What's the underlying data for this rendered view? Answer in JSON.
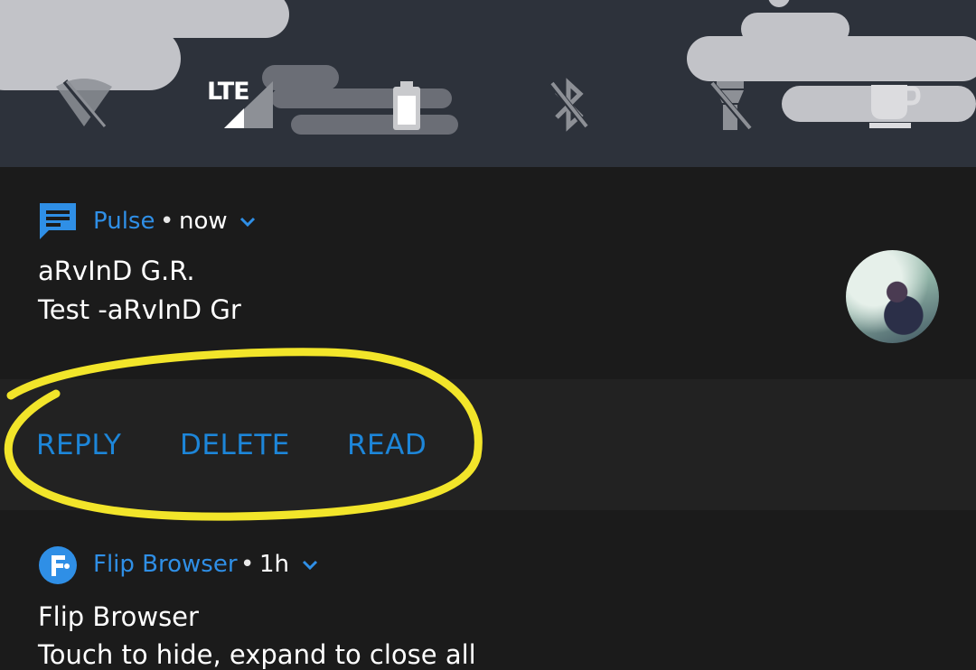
{
  "status_tiles": {
    "wifi": {
      "icon": "wifi-off-icon",
      "state": "off"
    },
    "cellular": {
      "icon": "signal-icon",
      "label": "LTE"
    },
    "battery": {
      "icon": "battery-icon"
    },
    "bluetooth": {
      "icon": "bluetooth-off-icon",
      "state": "off"
    },
    "flashlight": {
      "icon": "flashlight-off-icon",
      "state": "off"
    },
    "caffeine": {
      "icon": "coffee-cup-icon"
    }
  },
  "notifications": [
    {
      "app": "Pulse",
      "separator": "•",
      "time": "now",
      "icon": "message-icon",
      "title": "aRvInD G.R.",
      "text": "Test -aRvInD Gr",
      "avatar": "contact-avatar",
      "actions": [
        "REPLY",
        "DELETE",
        "READ"
      ]
    },
    {
      "app": "Flip Browser",
      "separator": "•",
      "time": "1h",
      "icon": "flip-browser-icon",
      "title": "Flip Browser",
      "text": "Touch to hide, expand to close all"
    }
  ],
  "colors": {
    "header_bg": "#2d323b",
    "panel_bg": "#1b1b1b",
    "actions_bg": "#222222",
    "accent": "#2f8fe6",
    "highlight": "#f2e52a"
  }
}
